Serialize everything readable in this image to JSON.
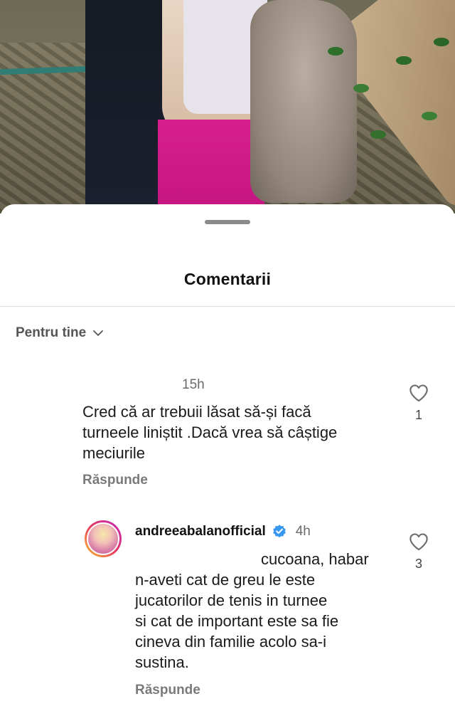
{
  "sheet": {
    "title": "Comentarii"
  },
  "sort": {
    "label": "Pentru tine"
  },
  "comments": [
    {
      "time": "15h",
      "text": "Cred că ar trebuii lăsat  să-și facă\nturneele liniștit .Dacă vrea să câștige\nmeciurile",
      "reply_label": "Răspunde",
      "likes": "1"
    },
    {
      "username": "andreeabalanofficial",
      "time": "4h",
      "text_first": "cucoana, habar",
      "text_rest": "n-aveti cat de greu le este\njucatorilor de tenis in turnee\nsi cat de important este sa fie\ncineva din familie acolo sa-i\nsustina.",
      "reply_label": "Răspunde",
      "likes": "3"
    }
  ],
  "icons": {
    "drag_handle": "drag-handle",
    "sort_chevron": "chevron-down-icon",
    "verified": "verified-badge-icon",
    "like": "heart-icon"
  },
  "colors": {
    "verified_blue": "#3897f0",
    "secondary_text": "#6b6b6b"
  }
}
